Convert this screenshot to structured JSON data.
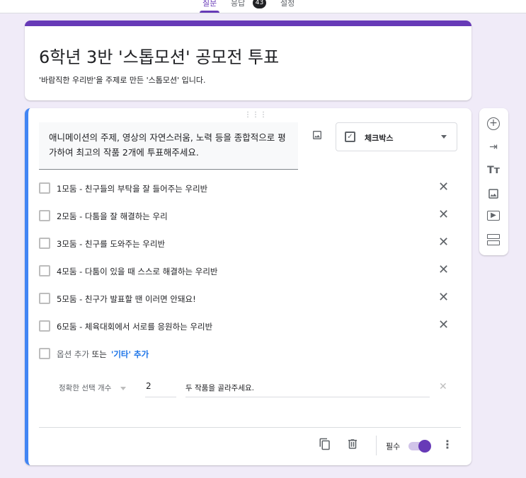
{
  "tabs": [
    {
      "label": "질문"
    },
    {
      "label": "응답"
    },
    {
      "label": "설정"
    }
  ],
  "response_count": "43",
  "form": {
    "title": "6학년 3반 '스톱모션' 공모전 투표",
    "description": "'바람직한 우리반'을 주제로 만든 '스톱모션' 입니다."
  },
  "question": {
    "text": "애니메이션의 주제, 영상의 자연스러움, 노력 등을 종합적으로 평가하여 최고의 작품 2개에 투표해주세요.",
    "type": "체크박스",
    "options": [
      "1모둠 - 친구들의 부탁을 잘 들어주는 우리반",
      "2모둠 - 다툼을 잘 해결하는 우리",
      "3모둠 - 친구를 도와주는 우리반",
      "4모둠 - 다툼이 있을 때 스스로 해결하는 우리반",
      "5모둠 - 친구가 발표할 땐 이러면 안돼요!",
      "6모둠 - 체육대회에서 서로를 응원하는 우리반"
    ],
    "add_option": "옵션 추가",
    "or": "또는",
    "add_other": "'기타' 추가",
    "validation": {
      "rule": "정확한 선택 개수",
      "count": "2",
      "error_text": "두 작품을 골라주세요."
    },
    "required_label": "필수",
    "required": true
  },
  "colors": {
    "accent": "#673ab7",
    "active": "#4285f4"
  }
}
